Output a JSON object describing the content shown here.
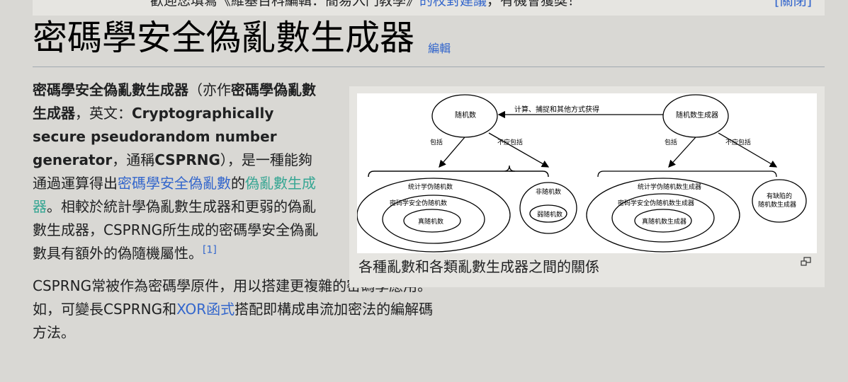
{
  "notice": {
    "text_before": "歡迎您填寫《維基百科編輯：簡易入門教學》",
    "link": "的校對建議",
    "text_after": "，有機會獲獎！",
    "close": "[關閉]"
  },
  "article": {
    "title": "密碼學安全偽亂數生成器",
    "edit_label": "編輯"
  },
  "paragraph1": {
    "term1": "密碼學安全偽亂數生成器",
    "t1": "（亦作",
    "term2": "密碼學偽亂數生成器",
    "t2": "，英文：",
    "term3": "Cryptographically secure pseudorandom number generator",
    "t3": "，通稱",
    "term4": "CSPRNG",
    "t4": "），是一種能夠通過運算得出",
    "link1": "密碼學安全偽亂數",
    "t5": "的",
    "link2": "偽亂數生成器",
    "t6": "。相較於統計學偽亂數生成器和更弱的偽亂數生成器，CSPRNG所生成的密碼學安全偽亂數具有額外的偽隨機屬性。",
    "ref": "[1]"
  },
  "paragraph2": {
    "t1": "CSPRNG常被作為密碼學原件，用以搭建更複雜的密碼學應用。如，可變長CSPRNG和",
    "link": "XOR函式",
    "t2": "搭配即構成串流加密法的編解碼方法。"
  },
  "figure": {
    "caption": "各種亂數和各類亂數生成器之間的關係",
    "magnify_icon": "magnify-icon",
    "diagram": {
      "node_random_number": "随机数",
      "node_rng": "随机数生成器",
      "arrow_label": "计算、捕捉和其他方式获得",
      "include": "包括",
      "should_not_include": "不应包括",
      "stat_prn": "统计学伪随机数",
      "crypto_prn": "密码学安全伪随机数",
      "true_rn": "真随机数",
      "non_rn": "非随机数",
      "weak_rn": "弱随机数",
      "stat_prng": "统计学伪随机数生成器",
      "crypto_prng": "密码学安全伪随机数生成器",
      "true_rng": "真随机数生成器",
      "flawed_rng_1": "有缺陷的",
      "flawed_rng_2": "随机数生成器"
    }
  }
}
